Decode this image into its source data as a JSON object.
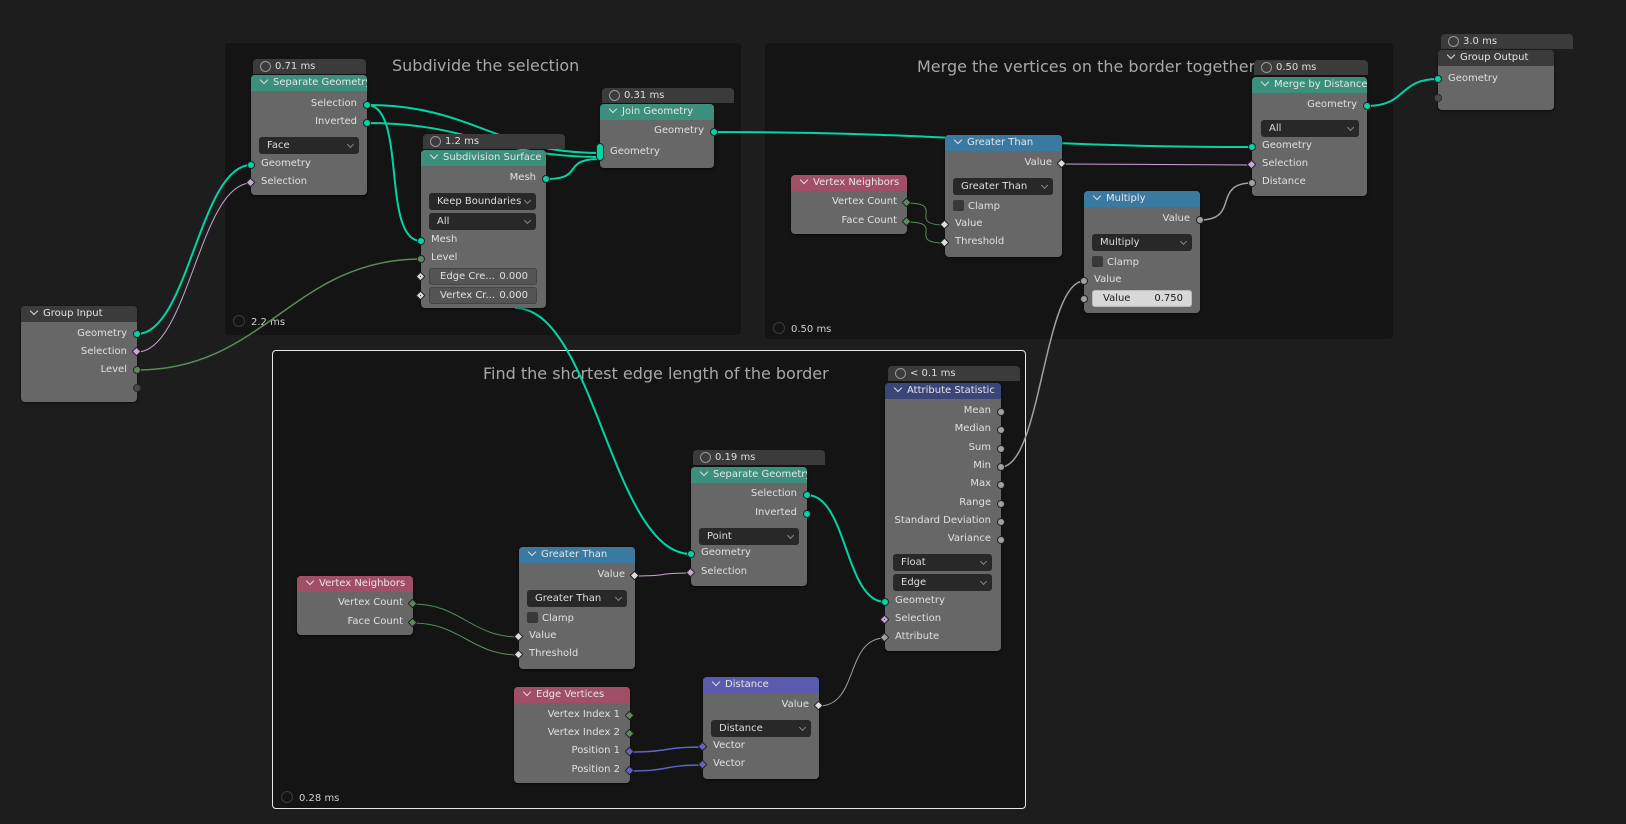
{
  "frames": [
    {
      "id": "subdivide",
      "label": "Subdivide the selection",
      "timer": "2.2 ms"
    },
    {
      "id": "merge",
      "label": "Merge the vertices on the border together",
      "timer": "0.50 ms"
    },
    {
      "id": "shortest",
      "label": "Find the shortest edge length of the border",
      "timer": "0.28 ms"
    }
  ],
  "nodes": {
    "group_input": {
      "title": "Group Input",
      "outputs": [
        "Geometry",
        "Selection",
        "Level"
      ]
    },
    "sep_geo_1": {
      "timer": "0.71 ms",
      "title": "Separate Geometry",
      "outputs": [
        "Selection",
        "Inverted"
      ],
      "domain": "Face",
      "inputs": [
        "Geometry",
        "Selection"
      ]
    },
    "subdiv": {
      "timer": "1.2 ms",
      "title": "Subdivision Surface",
      "outputs": [
        "Mesh"
      ],
      "boundary": "Keep Boundaries",
      "uv_smooth": "All",
      "inputs": [
        "Mesh",
        "Level"
      ],
      "edge_crease": {
        "label": "Edge Cre...",
        "value": "0.000"
      },
      "vertex_crease": {
        "label": "Vertex Cr...",
        "value": "0.000"
      }
    },
    "join_geo": {
      "timer": "0.31 ms",
      "title": "Join Geometry",
      "outputs": [
        "Geometry"
      ],
      "inputs": [
        "Geometry"
      ]
    },
    "vn_1": {
      "title": "Vertex Neighbors",
      "outputs": [
        "Vertex Count",
        "Face Count"
      ]
    },
    "gt_1": {
      "title": "Greater Than",
      "outputs": [
        "Value"
      ],
      "operation": "Greater Than",
      "clamp": "Clamp",
      "inputs": [
        "Value",
        "Threshold"
      ]
    },
    "multiply": {
      "title": "Multiply",
      "outputs": [
        "Value"
      ],
      "operation": "Multiply",
      "clamp": "Clamp",
      "inputs": [
        "Value"
      ],
      "value_field": {
        "label": "Value",
        "value": "0.750"
      }
    },
    "merge": {
      "timer": "0.50 ms",
      "title": "Merge by Distance",
      "outputs": [
        "Geometry"
      ],
      "mode": "All",
      "inputs": [
        "Geometry",
        "Selection",
        "Distance"
      ]
    },
    "group_output": {
      "timer": "3.0 ms",
      "title": "Group Output",
      "inputs": [
        "Geometry"
      ]
    },
    "attr_stat": {
      "timer": "< 0.1 ms",
      "title": "Attribute Statistic",
      "outputs": [
        "Mean",
        "Median",
        "Sum",
        "Min",
        "Max",
        "Range",
        "Standard Deviation",
        "Variance"
      ],
      "data_type": "Float",
      "domain": "Edge",
      "inputs": [
        "Geometry",
        "Selection",
        "Attribute"
      ]
    },
    "sep_geo_2": {
      "timer": "0.19 ms",
      "title": "Separate Geometry",
      "outputs": [
        "Selection",
        "Inverted"
      ],
      "domain": "Point",
      "inputs": [
        "Geometry",
        "Selection"
      ]
    },
    "gt_2": {
      "title": "Greater Than",
      "outputs": [
        "Value"
      ],
      "operation": "Greater Than",
      "clamp": "Clamp",
      "inputs": [
        "Value",
        "Threshold"
      ]
    },
    "vn_2": {
      "title": "Vertex Neighbors",
      "outputs": [
        "Vertex Count",
        "Face Count"
      ]
    },
    "edge_verts": {
      "title": "Edge Vertices",
      "outputs": [
        "Vertex Index 1",
        "Vertex Index 2",
        "Position 1",
        "Position 2"
      ]
    },
    "distance": {
      "title": "Distance",
      "outputs": [
        "Value"
      ],
      "operation": "Distance",
      "inputs": [
        "Vector",
        "Vector"
      ]
    }
  },
  "colors": {
    "geometry": "#00d6a3",
    "boolean": "#cca6d6",
    "integer": "#598c5c",
    "float": "#a1a1a1",
    "vector": "#6363c7",
    "header_geometry": "#3b8f7b",
    "header_converter": "#3b7aa0",
    "header_input": "#a04f66",
    "header_vector": "#5b5bad",
    "header_attribute": "#3a4677"
  }
}
